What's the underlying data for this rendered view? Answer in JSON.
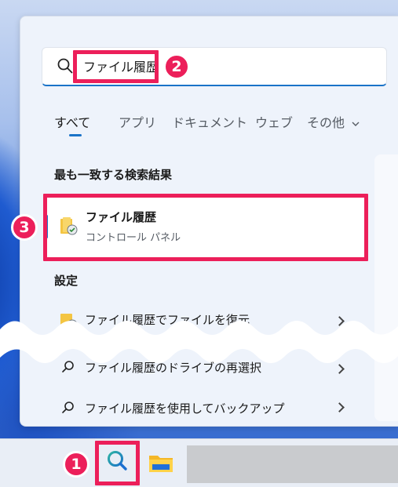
{
  "search": {
    "query": "ファイル履歴"
  },
  "tabs": [
    {
      "label": "すべて"
    },
    {
      "label": "アプリ"
    },
    {
      "label": "ドキュメント"
    },
    {
      "label": "ウェブ"
    },
    {
      "label": "その他"
    }
  ],
  "best_match": {
    "heading": "最も一致する検索結果",
    "title": "ファイル履歴",
    "subtitle": "コントロール パネル"
  },
  "settings": {
    "heading": "設定",
    "items": [
      {
        "label": "ファイル履歴でファイルを復元"
      },
      {
        "label": "ファイル履歴のドライブの再選択"
      },
      {
        "label": "ファイル履歴を使用してバックアップ"
      }
    ]
  },
  "annotations": {
    "step1": "1",
    "step2": "2",
    "step3": "3"
  },
  "colors": {
    "highlight": "#ec1f5a",
    "accent": "#1a73c8",
    "panel": "#eef3fb"
  },
  "icons": [
    "search-icon",
    "folder-history-icon",
    "chevron-right-icon",
    "file-explorer-icon",
    "chevron-down-icon"
  ]
}
